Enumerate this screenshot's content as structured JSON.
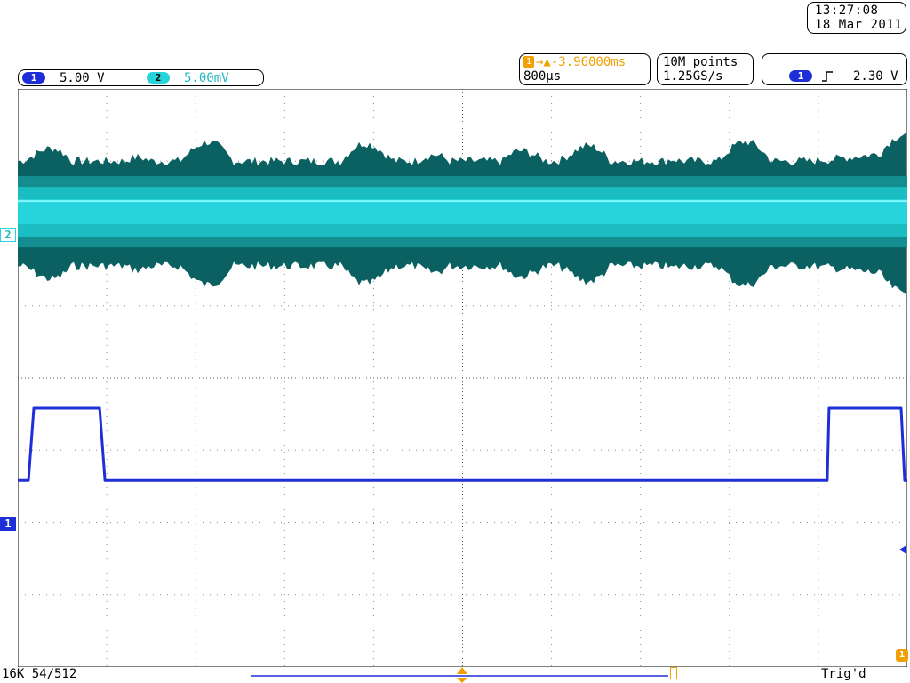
{
  "header": {
    "time": "13:27:08",
    "date": "18 Mar 2011"
  },
  "channels": [
    {
      "id": "1",
      "scale": "5.00 V",
      "color": "#1f2fd8"
    },
    {
      "id": "2",
      "scale": "5.00mV",
      "color": "#27d4dc"
    }
  ],
  "horizontal": {
    "marker": "1",
    "delay": "→▲-3.96000ms",
    "timebase": "800μs"
  },
  "acquisition": {
    "record_length": "10M points",
    "sample_rate": "1.25GS/s"
  },
  "trigger": {
    "source": "1",
    "slope_icon": "rising-edge-icon",
    "level": "2.30 V"
  },
  "footer": {
    "waveforms": "16K 54/512",
    "status": "Trig'd"
  },
  "chart_data": {
    "type": "line",
    "grid": "on",
    "series": [
      {
        "id": "2",
        "color": "#27d4dc",
        "envelope_color": "#0b6161",
        "description": "noise band with bursts",
        "band_center_div": 2.3
      },
      {
        "id": "1",
        "color": "#1f2fd8",
        "description": "square pulse",
        "levels_div": [
          1.6,
          0.6
        ],
        "transitions_x_div": [
          0.15,
          0.95,
          9.1,
          9.97
        ]
      }
    ],
    "xlim": [
      0,
      10
    ],
    "ylim": [
      -4,
      4
    ],
    "x_divisions": 10,
    "y_divisions": 8
  }
}
